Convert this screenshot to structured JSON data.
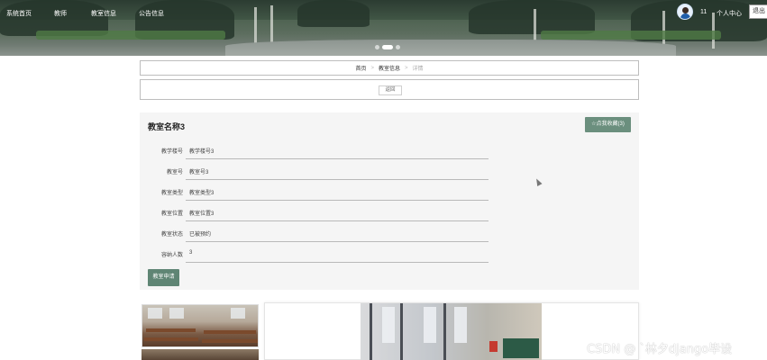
{
  "nav": {
    "items": [
      "系统首页",
      "教师",
      "教室信息",
      "公告信息"
    ]
  },
  "user": {
    "name": "11",
    "center_label": "个人中心",
    "logout_label": "退出"
  },
  "banner": {
    "slide_count": 3,
    "active_slide": 1
  },
  "breadcrumb": {
    "items": [
      "首页",
      "教室信息",
      "详情"
    ],
    "separator": ">"
  },
  "back_button": "返回",
  "detail": {
    "title": "教室名称3",
    "favorite_button": "☆点我收藏(3)",
    "fields": [
      {
        "label": "教学楼号",
        "value": "教学楼号3"
      },
      {
        "label": "教室号",
        "value": "教室号3"
      },
      {
        "label": "教室类型",
        "value": "教室类型3"
      },
      {
        "label": "教室位置",
        "value": "教室位置3"
      },
      {
        "label": "教室状态",
        "value": "已被预约"
      },
      {
        "label": "容纳人数",
        "value": "3"
      }
    ],
    "apply_button": "教室申请"
  },
  "watermark": "CSDN @ `林夕django毕设",
  "colors": {
    "accent": "#6b8f7e",
    "accent_dark": "#5f8574"
  }
}
